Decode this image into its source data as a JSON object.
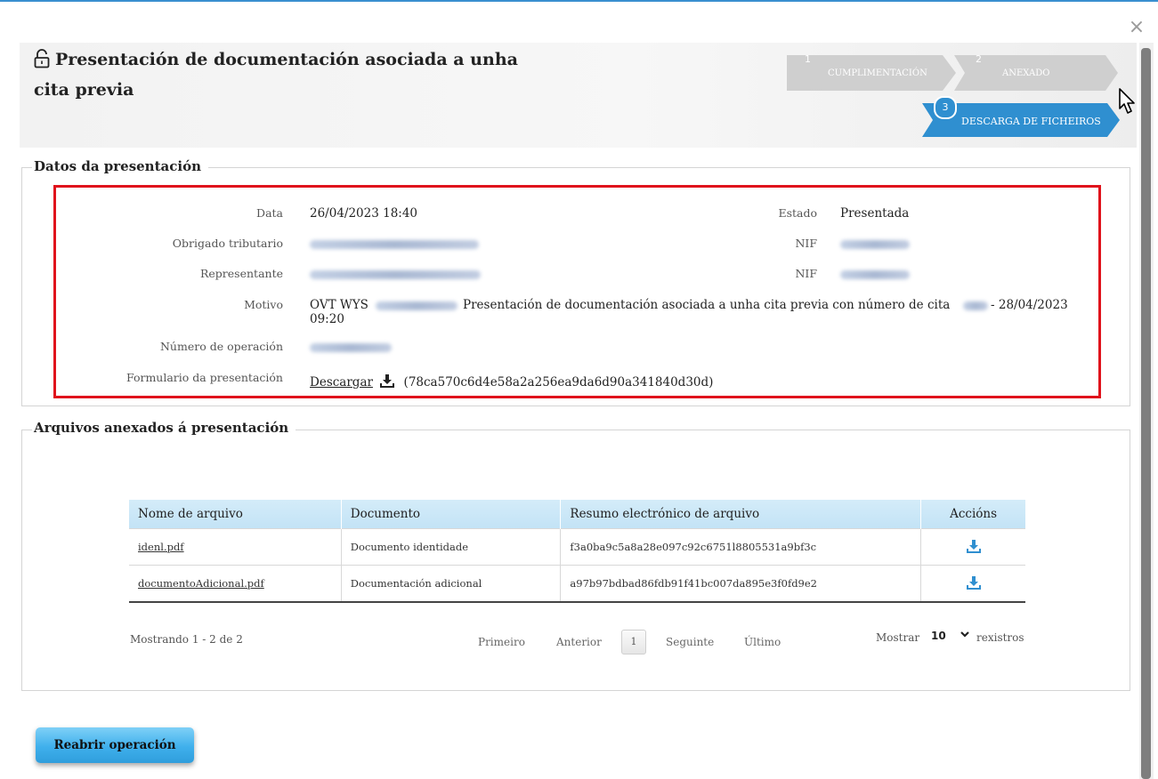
{
  "dialog": {
    "title": "Presentación de documentación asociada a unha cita previa",
    "close_glyph": "×"
  },
  "wizard": {
    "steps": [
      {
        "number": "1",
        "label": "CUMPLIMENTACIÓN",
        "state": "done"
      },
      {
        "number": "2",
        "label": "ANEXADO",
        "state": "done"
      },
      {
        "number": "3",
        "label": "DESCARGA DE FICHEIROS",
        "state": "active"
      }
    ],
    "colors": {
      "active": "#2f8fd0",
      "inactive": "#cfcfcf"
    }
  },
  "presentation": {
    "legend": "Datos da presentación",
    "fields": {
      "data_label": "Data",
      "data_value": "26/04/2023 18:40",
      "estado_label": "Estado",
      "estado_value": "Presentada",
      "obrigado_label": "Obrigado tributario",
      "nif_label": "NIF",
      "representante_label": "Representante",
      "nif2_label": "NIF",
      "motivo_label": "Motivo",
      "motivo_prefix": "OVT WYS",
      "motivo_mid": "Presentación de documentación asociada a unha cita previa con número de cita",
      "motivo_date": "- 28/04/2023",
      "motivo_time": "09:20",
      "operacion_label": "Número de operación",
      "formulario_label": "Formulario da presentación",
      "formulario_link": "Descargar",
      "formulario_hash": "(78ca570c6d4e58a2a256ea9da6d90a341840d30d)"
    },
    "highlight_color": "#e0131c"
  },
  "attachments": {
    "legend": "Arquivos anexados á presentación",
    "columns": [
      "Nome de arquivo",
      "Documento",
      "Resumo electrónico de arquivo",
      "Accións"
    ],
    "rows": [
      {
        "file": "idenl.pdf",
        "document": "Documento identidade",
        "hash": "f3a0ba9c5a8a28e097c92c6751l8805531a9bf3c"
      },
      {
        "file": "documentoAdicional.pdf",
        "document": "Documentación adicional",
        "hash": "a97b97bdbad86fdb91f41bc007da895e3f0fd9e2"
      }
    ],
    "pager": {
      "showing": "Mostrando 1 - 2 de 2",
      "first": "Primeiro",
      "previous": "Anterior",
      "page": "1",
      "next": "Seguinte",
      "last": "Último",
      "show_label": "Mostrar",
      "page_size": "10",
      "records_label": "rexistros"
    }
  },
  "actions": {
    "reopen": "Reabrir operación"
  },
  "icons": {
    "lock": "unlock-icon",
    "download": "download-icon",
    "close": "close-icon",
    "cursor": "mouse-cursor-icon"
  }
}
